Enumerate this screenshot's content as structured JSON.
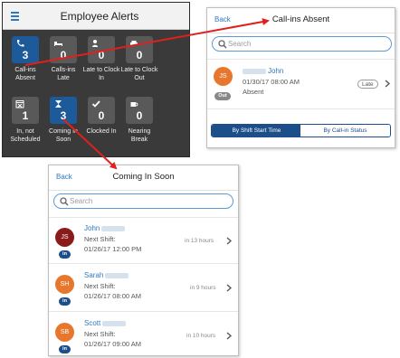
{
  "alerts": {
    "title": "Employee Alerts",
    "tiles": [
      {
        "icon": "phone-icon",
        "count": "3",
        "label": "Call-ins Absent",
        "active": true
      },
      {
        "icon": "bed-icon",
        "count": "0",
        "label": "Calls-ins Late",
        "active": false
      },
      {
        "icon": "person-icon",
        "count": "0",
        "label": "Late to Clock In",
        "active": false
      },
      {
        "icon": "car-icon",
        "count": "0",
        "label": "Late to Clock Out",
        "active": false
      },
      {
        "icon": "calendar-x-icon",
        "count": "1",
        "label": "In, not Scheduled",
        "active": false
      },
      {
        "icon": "hourglass-icon",
        "count": "3",
        "label": "Coming In Soon",
        "active": true
      },
      {
        "icon": "checkmark-icon",
        "count": "0",
        "label": "Clocked In",
        "active": false
      },
      {
        "icon": "coffee-cup-icon",
        "count": "0",
        "label": "Nearing Break",
        "active": false
      }
    ]
  },
  "absent": {
    "back": "Back",
    "title": "Call-ins Absent",
    "search_placeholder": "Search",
    "row": {
      "initials": "JS",
      "name": "John",
      "datetime": "01/30/17 08:00 AM",
      "status": "Absent",
      "badge": "Out",
      "tag": "Late",
      "avatar_color": "#e8772e"
    },
    "segments": {
      "left": "By Shift Start Time",
      "right": "By Call-in Status"
    }
  },
  "soon": {
    "back": "Back",
    "title": "Coming In Soon",
    "search_placeholder": "Search",
    "rows": [
      {
        "initials": "JS",
        "name": "John",
        "label": "Next Shift:",
        "datetime": "01/26/17 12:00 PM",
        "eta": "in 13 hours",
        "badge": "in",
        "avatar_color": "#8b1a1a"
      },
      {
        "initials": "SH",
        "name": "Sarah",
        "label": "Next Shift:",
        "datetime": "01/26/17 08:00 AM",
        "eta": "in 9 hours",
        "badge": "in",
        "avatar_color": "#e8772e"
      },
      {
        "initials": "SB",
        "name": "Scott",
        "label": "Next Shift:",
        "datetime": "01/26/17 09:00 AM",
        "eta": "in 10 hours",
        "badge": "in",
        "avatar_color": "#e8772e"
      }
    ]
  },
  "colors": {
    "accent": "#2f78c0",
    "tile_active": "#1c5a9a",
    "arrow": "#e0201c"
  }
}
